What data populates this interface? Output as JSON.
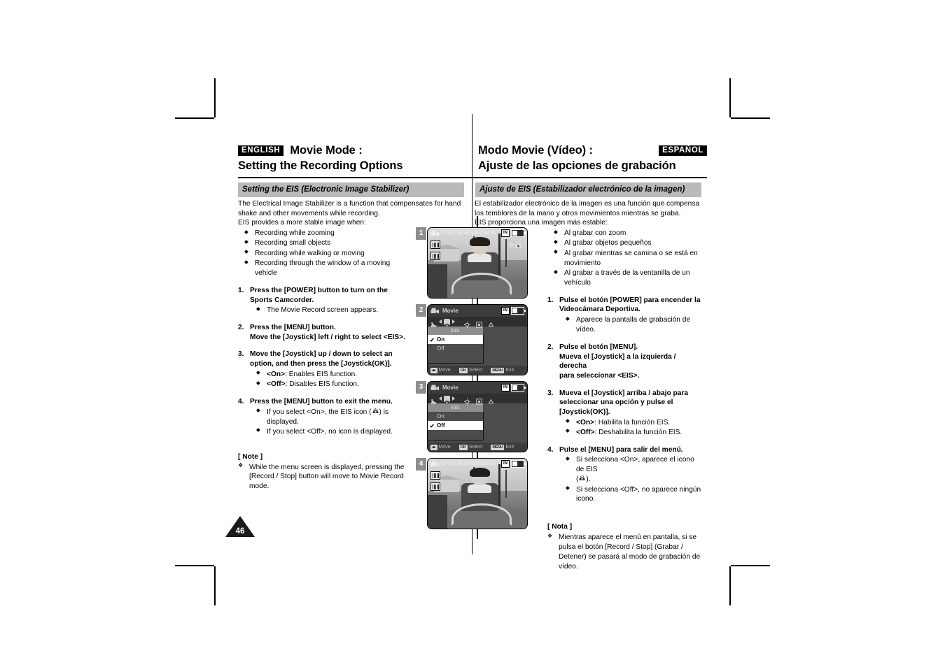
{
  "header": {
    "english_tag": "ENGLISH",
    "spanish_tag": "ESPAÑOL",
    "en_title_line1": "Movie Mode :",
    "en_title_line2": "Setting the Recording Options",
    "es_title_line1": "Modo Movie (Vídeo) :",
    "es_title_line2": "Ajuste de las opciones de grabación"
  },
  "section": {
    "en_bar": "Setting the EIS (Electronic Image Stabilizer)",
    "es_bar": "Ajuste de EIS (Estabilizador electrónico de la imagen)"
  },
  "english": {
    "intro_line1": "The Electrical Image Stabilizer is a function that compensates for hand",
    "intro_line2": "shake and other movements while recording.",
    "intro_line3": "EIS provides a more stable image when:",
    "bullets": [
      "Recording while zooming",
      "Recording small objects",
      "Recording while walking or moving",
      "Recording through the  window of a moving vehicle"
    ],
    "steps": [
      {
        "title": "Press the [POWER] button to turn on the Sports Camcorder.",
        "bullets_plain": [
          "The Movie Record screen appears."
        ]
      },
      {
        "title_line1": "Press the [MENU] button.",
        "title_line2": "Move the [Joystick] left / right to select <EIS>."
      },
      {
        "title_line1": "Move the [Joystick] up / down to select an",
        "title_line2": "option, and then press the [Joystick(OK)].",
        "bullet_on_label": "<On>",
        "bullet_on_text": ": Enables EIS function.",
        "bullet_off_label": "<Off>",
        "bullet_off_text": ": Disables EIS function."
      },
      {
        "title": "Press the [MENU] button to exit the menu.",
        "bullet1_pre": "If you select <On>, the EIS icon (",
        "bullet1_post": ") is displayed.",
        "bullet2": "If you select <Off>, no icon is displayed."
      }
    ],
    "note_title": "[ Note ]",
    "note_text": "While the menu screen is displayed, pressing the [Record / Stop] button will move to Movie Record mode."
  },
  "spanish": {
    "intro_line1": "El estabilizador electrónico de la imagen es una función que compensa",
    "intro_line2": "los temblores de la mano y otros movimientos mientras se graba.",
    "intro_line3": "EIS proporciona una imagen más estable:",
    "bullets": [
      "Al grabar con zoom",
      "Al grabar objetos pequeños",
      "Al grabar mientras se camina o se está en movimiento",
      "Al grabar a través de la ventanilla de un vehículo"
    ],
    "steps": [
      {
        "title": "Pulse el botón [POWER] para encender la Videocámara Deportiva.",
        "bullets_plain": [
          "Aparece la pantalla de grabación de vídeo."
        ]
      },
      {
        "title_line1": "Pulse el botón [MENU].",
        "title_line2": "Mueva el [Joystick] a la izquierda / derecha",
        "title_line3": "para seleccionar <EIS>."
      },
      {
        "title_line1": "Mueva el [Joystick] arriba / abajo para",
        "title_line2": "seleccionar una opción y pulse el [Joystick(OK)].",
        "bullet_on_label": "<On>",
        "bullet_on_text": ": Habilita la función EIS.",
        "bullet_off_label": "<Off>",
        "bullet_off_text": ": Deshabilita la función EIS."
      },
      {
        "title": "Pulse el [MENU] para salir del menú.",
        "bullet1_pre": "Si selecciona <On>, aparece el icono de EIS",
        "bullet1_post": ").",
        "bullet1_paren_open": "(",
        "bullet2": "Si selecciona <Off>, no aparece ningún icono."
      }
    ],
    "note_title": "[ Nota ]",
    "note_text": "Mientras aparece el menú en pantalla, si se pulsa el botón [Record / Stop] (Grabar / Detener) se pasará al modo de grabación de vídeo."
  },
  "figures": [
    {
      "number": "1",
      "type": "liveview",
      "osd_status": "STBY",
      "osd_time": "00:00:00/00:50:00",
      "osd_memory": "IN",
      "has_eis_icon": true
    },
    {
      "number": "2",
      "type": "menu",
      "menu_title": "Movie",
      "osd_memory": "IN",
      "submenu_label": "EIS",
      "options": [
        "On",
        "Off"
      ],
      "selected": "On",
      "footer": [
        {
          "key": "◂▸",
          "label": "Move"
        },
        {
          "key": "OK",
          "label": "Select"
        },
        {
          "key": "MENU",
          "label": "Exit"
        }
      ]
    },
    {
      "number": "3",
      "type": "menu",
      "menu_title": "Movie",
      "osd_memory": "IN",
      "submenu_label": "EIS",
      "options": [
        "On",
        "Off"
      ],
      "selected": "Off",
      "footer": [
        {
          "key": "◂▸",
          "label": "Move"
        },
        {
          "key": "OK",
          "label": "Select"
        },
        {
          "key": "MENU",
          "label": "Exit"
        }
      ]
    },
    {
      "number": "4",
      "type": "liveview",
      "osd_status": "STBY",
      "osd_time": "00:00:00/00:50:00",
      "osd_memory": "IN",
      "has_eis_icon": false
    }
  ],
  "page_number": "46",
  "colors": {
    "section_bar": "#b9b9b9",
    "lang_tag_bg": "#000000",
    "figure_number_bg": "#8e8e8e",
    "page_number_bg": "#1a1a1a"
  }
}
